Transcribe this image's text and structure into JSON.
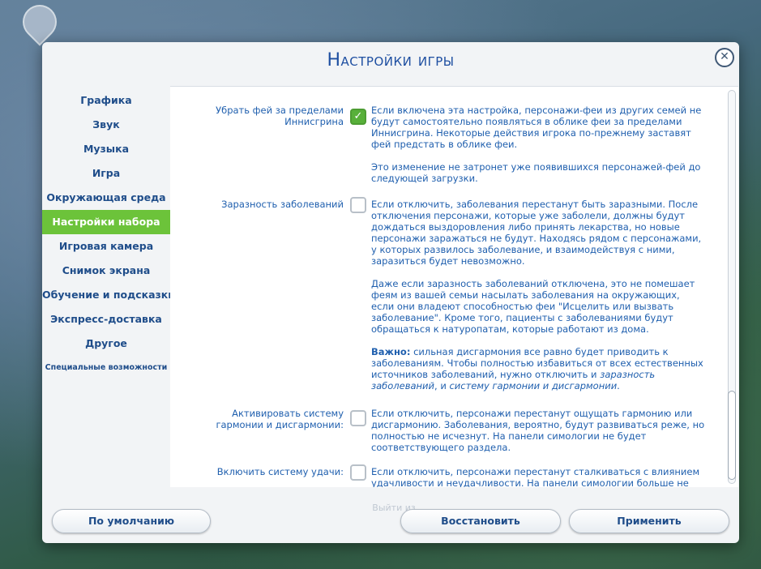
{
  "dialog": {
    "title": "Настройки игры",
    "close_symbol": "✕"
  },
  "sidebar": {
    "items": [
      {
        "label": "Графика"
      },
      {
        "label": "Звук"
      },
      {
        "label": "Музыка"
      },
      {
        "label": "Игра"
      },
      {
        "label": "Окружающая среда"
      },
      {
        "label": "Настройки набора",
        "active": true
      },
      {
        "label": "Игровая камера"
      },
      {
        "label": "Снимок экрана"
      },
      {
        "label": "Обучение и подсказки"
      },
      {
        "label": "Экспресс-доставка"
      },
      {
        "label": "Другое"
      },
      {
        "label": "Специальные возможности"
      }
    ]
  },
  "settings": [
    {
      "label": "Убрать фей за пределами Иннисгрина",
      "checked": true,
      "desc1": "Если включена эта настройка, персонажи-феи из других семей не будут самостоятельно появляться в облике феи за пределами Иннисгрина. Некоторые действия игрока по-прежнему заставят фей предстать в облике феи.",
      "desc2": "Это изменение не затронет уже появившихся персонажей-фей до следующей загрузки."
    },
    {
      "label": "Заразность заболеваний",
      "checked": false,
      "desc1": "Если отключить, заболевания перестанут быть заразными. После отключения персонажи, которые уже заболели, должны будут дождаться выздоровления либо принять лекарства, но новые персонажи заражаться не будут. Находясь рядом с персонажами, у которых развилось заболевание, и взаимодействуя с ними, заразиться будет невозможно.",
      "desc2": "Даже если заразность заболеваний отключена, это не помешает феям из вашей семьи насылать заболевания на окружающих, если они владеют способностью феи \"Исцелить или вызвать заболевание\". Кроме того, пациенты с заболеваниями будут обращаться к натуропатам, которые работают из дома.",
      "important_label": "Важно:",
      "desc3_a": " сильная дисгармония все равно будет приводить к заболеваниям. Чтобы полностью избавиться от всех естественных источников заболеваний, нужно отключить и ",
      "desc3_i1": "заразность заболеваний",
      "desc3_b": ", и ",
      "desc3_i2": "систему гармонии и дисгармонии",
      "desc3_c": "."
    },
    {
      "label": "Активировать систему гармонии и дисгармонии:",
      "checked": false,
      "desc1": "Если отключить, персонажи перестанут ощущать гармонию или дисгармонию. Заболевания, вероятно, будут развиваться реже, но полностью не исчезнут. На панели симологии не будет соответствующего раздела."
    },
    {
      "label": "Включить систему удачи:",
      "checked": false,
      "desc1": "Если отключить, персонажи перестанут сталкиваться с влиянием удачливости и неудачливости. На панели симологии больше не"
    }
  ],
  "footer": {
    "default_button": "По умолчанию",
    "ghost_text": "Выйти из",
    "restore_button": "Восстановить",
    "apply_button": "Применить"
  },
  "colors": {
    "accent_active": "#6cc33a",
    "title_blue": "#1e4fa1",
    "text_blue": "#1f5fae"
  }
}
